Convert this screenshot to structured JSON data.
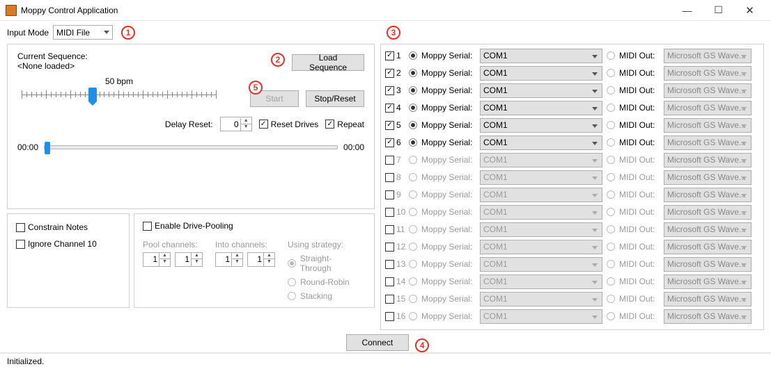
{
  "window": {
    "title": "Moppy Control Application"
  },
  "input_mode": {
    "label": "Input Mode",
    "value": "MIDI File"
  },
  "sequence": {
    "current_label": "Current Sequence:",
    "current_value": "<None loaded>",
    "load_btn": "Load Sequence",
    "bpm_label": "50 bpm",
    "start_btn": "Start",
    "stop_btn": "Stop/Reset",
    "delay_reset_label": "Delay Reset:",
    "delay_reset_value": "0",
    "reset_drives_label": "Reset Drives",
    "repeat_label": "Repeat",
    "time_start": "00:00",
    "time_end": "00:00"
  },
  "options": {
    "constrain_label": "Constrain Notes",
    "ignore10_label": "Ignore Channel 10"
  },
  "pool": {
    "enable_label": "Enable Drive-Pooling",
    "pool_channels_label": "Pool channels:",
    "into_channels_label": "Into channels:",
    "pool_from": "1",
    "pool_to": "1",
    "into_from": "1",
    "into_to": "1",
    "strategy_label": "Using strategy:",
    "strategy_options": [
      "Straight-Through",
      "Round-Robin",
      "Stacking"
    ]
  },
  "connect_btn": "Connect",
  "status": "Initialized.",
  "channel_labels": {
    "moppy": "Moppy Serial:",
    "midi": "MIDI Out:"
  },
  "channels": [
    {
      "n": "1",
      "enabled": true,
      "com": "COM1",
      "out": "Microsoft GS Wave..."
    },
    {
      "n": "2",
      "enabled": true,
      "com": "COM1",
      "out": "Microsoft GS Wave..."
    },
    {
      "n": "3",
      "enabled": true,
      "com": "COM1",
      "out": "Microsoft GS Wave..."
    },
    {
      "n": "4",
      "enabled": true,
      "com": "COM1",
      "out": "Microsoft GS Wave..."
    },
    {
      "n": "5",
      "enabled": true,
      "com": "COM1",
      "out": "Microsoft GS Wave..."
    },
    {
      "n": "6",
      "enabled": true,
      "com": "COM1",
      "out": "Microsoft GS Wave..."
    },
    {
      "n": "7",
      "enabled": false,
      "com": "COM1",
      "out": "Microsoft GS Wave..."
    },
    {
      "n": "8",
      "enabled": false,
      "com": "COM1",
      "out": "Microsoft GS Wave..."
    },
    {
      "n": "9",
      "enabled": false,
      "com": "COM1",
      "out": "Microsoft GS Wave..."
    },
    {
      "n": "10",
      "enabled": false,
      "com": "COM1",
      "out": "Microsoft GS Wave..."
    },
    {
      "n": "11",
      "enabled": false,
      "com": "COM1",
      "out": "Microsoft GS Wave..."
    },
    {
      "n": "12",
      "enabled": false,
      "com": "COM1",
      "out": "Microsoft GS Wave..."
    },
    {
      "n": "13",
      "enabled": false,
      "com": "COM1",
      "out": "Microsoft GS Wave..."
    },
    {
      "n": "14",
      "enabled": false,
      "com": "COM1",
      "out": "Microsoft GS Wave..."
    },
    {
      "n": "15",
      "enabled": false,
      "com": "COM1",
      "out": "Microsoft GS Wave..."
    },
    {
      "n": "16",
      "enabled": false,
      "com": "COM1",
      "out": "Microsoft GS Wave..."
    }
  ],
  "callouts": {
    "1": "1",
    "2": "2",
    "3": "3",
    "4": "4",
    "5": "5"
  }
}
